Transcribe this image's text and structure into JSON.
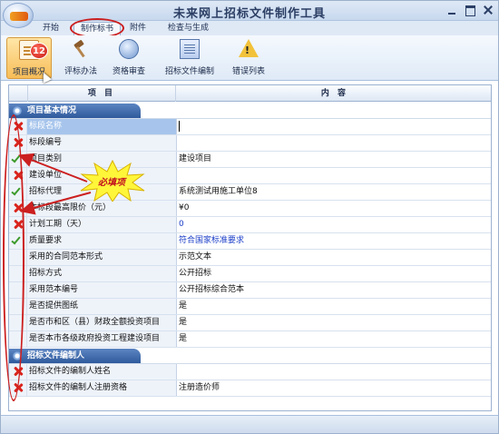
{
  "window": {
    "title": "未来网上招标文件制作工具"
  },
  "menu": {
    "tabs": [
      "开始",
      "制作标书",
      "附件",
      "检查与生成"
    ],
    "active_tab": "制作标书"
  },
  "ribbon": {
    "buttons": [
      {
        "label": "项目概况",
        "icon": "document-icon",
        "badge": "12"
      },
      {
        "label": "评标办法",
        "icon": "gavel-icon"
      },
      {
        "label": "资格审查",
        "icon": "review-icon"
      },
      {
        "label": "招标文件编制",
        "icon": "document-edit-icon"
      },
      {
        "label": "错误列表",
        "icon": "warning-icon"
      }
    ]
  },
  "grid": {
    "header": {
      "col_item": "项 目",
      "col_content": "内 容"
    },
    "sections": [
      {
        "title": "项目基本情况",
        "rows": [
          {
            "status": "error",
            "name": "标段名称",
            "value": "",
            "selected": true
          },
          {
            "status": "error",
            "name": "标段编号",
            "value": ""
          },
          {
            "status": "ok",
            "name": "项目类别",
            "value": "建设项目"
          },
          {
            "status": "error",
            "name": "建设单位",
            "value": ""
          },
          {
            "status": "ok",
            "name": "招标代理",
            "value": "系统测试用施工单位8"
          },
          {
            "status": "error",
            "name": "本标段最高限价（元）",
            "value": "¥0"
          },
          {
            "status": "error",
            "name": "计划工期（天）",
            "value": "0",
            "blue": true
          },
          {
            "status": "ok",
            "name": "质量要求",
            "value": "符合国家标准要求",
            "blue": true
          },
          {
            "status": "",
            "name": "采用的合同范本形式",
            "value": "示范文本"
          },
          {
            "status": "",
            "name": "招标方式",
            "value": "公开招标"
          },
          {
            "status": "",
            "name": "采用范本编号",
            "value": "公开招标综合范本"
          },
          {
            "status": "",
            "name": "是否提供图纸",
            "value": "是"
          },
          {
            "status": "",
            "name": "是否市和区（县）财政全额投资项目",
            "value": "是"
          },
          {
            "status": "",
            "name": "是否本市各级政府投资工程建设项目",
            "value": "是"
          }
        ]
      },
      {
        "title": "招标文件编制人",
        "rows": [
          {
            "status": "error",
            "name": "招标文件的编制人姓名",
            "value": ""
          },
          {
            "status": "error",
            "name": "招标文件的编制人注册资格",
            "value": "注册造价师"
          }
        ]
      }
    ]
  },
  "annotation": {
    "callout": "必填项"
  },
  "colors": {
    "error": "#d9241d",
    "ok": "#3c9a2a",
    "accent": "#2f5a9c",
    "annotation": "#cc1f1f"
  }
}
